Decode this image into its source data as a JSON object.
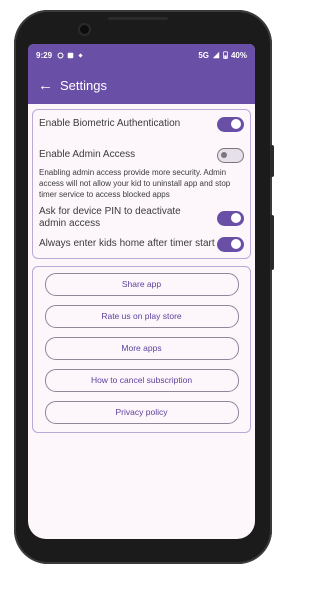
{
  "status_bar": {
    "time": "9:29",
    "network": "5G",
    "battery": "40%"
  },
  "app_bar": {
    "title": "Settings"
  },
  "settings": {
    "biometric": {
      "label": "Enable Biometric Authentication",
      "enabled": true
    },
    "admin_access": {
      "label": "Enable Admin Access",
      "enabled": false
    },
    "admin_description": "Enabling admin access provide more security. Admin access will not allow your kid to uninstall app and stop timer service to access blocked apps",
    "device_pin": {
      "label": "Ask for device PIN to deactivate admin access",
      "enabled": true
    },
    "kids_home": {
      "label": "Always enter kids home after timer start",
      "enabled": true
    }
  },
  "buttons": {
    "share": "Share app",
    "rate": "Rate us on play store",
    "more_apps": "More apps",
    "cancel_subscription": "How to cancel subscription",
    "privacy": "Privacy policy"
  },
  "colors": {
    "primary": "#6a4fa7",
    "background": "#fdf7fc",
    "outline": "#b9a9d8"
  }
}
